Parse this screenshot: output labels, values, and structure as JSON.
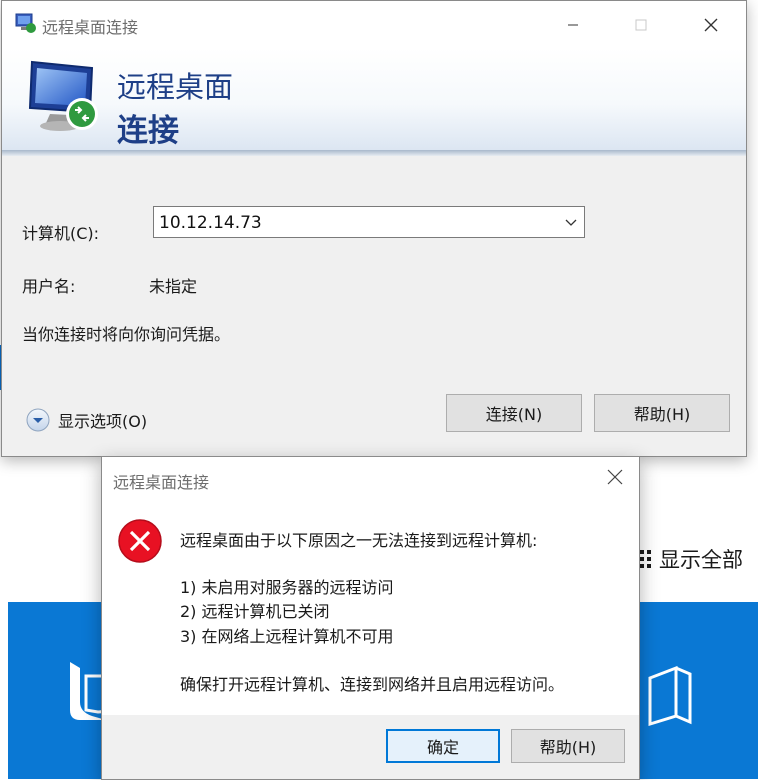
{
  "background": {
    "show_all_label": "显示全部"
  },
  "rdp_window": {
    "title": "远程桌面连接",
    "banner_line1": "远程桌面",
    "banner_line2": "连接",
    "computer_label": "计算机(C):",
    "computer_value": "10.12.14.73",
    "username_label": "用户名:",
    "username_value": "未指定",
    "credentials_note": "当你连接时将向你询问凭据。",
    "show_options_label": "显示选项(O)",
    "connect_button": "连接(N)",
    "help_button": "帮助(H)"
  },
  "error_dialog": {
    "title": "远程桌面连接",
    "message_intro": "远程桌面由于以下原因之一无法连接到远程计算机:",
    "reasons": [
      "1) 未启用对服务器的远程访问",
      "2) 远程计算机已关闭",
      "3) 在网络上远程计算机不可用"
    ],
    "advice": "确保打开远程计算机、连接到网络并且启用远程访问。",
    "ok_button": "确定",
    "help_button": "帮助(H)"
  },
  "colors": {
    "banner_title": "#1e3f87",
    "accent_blue": "#0078d7",
    "error_red": "#e81123",
    "background_band": "#0a78d4"
  }
}
